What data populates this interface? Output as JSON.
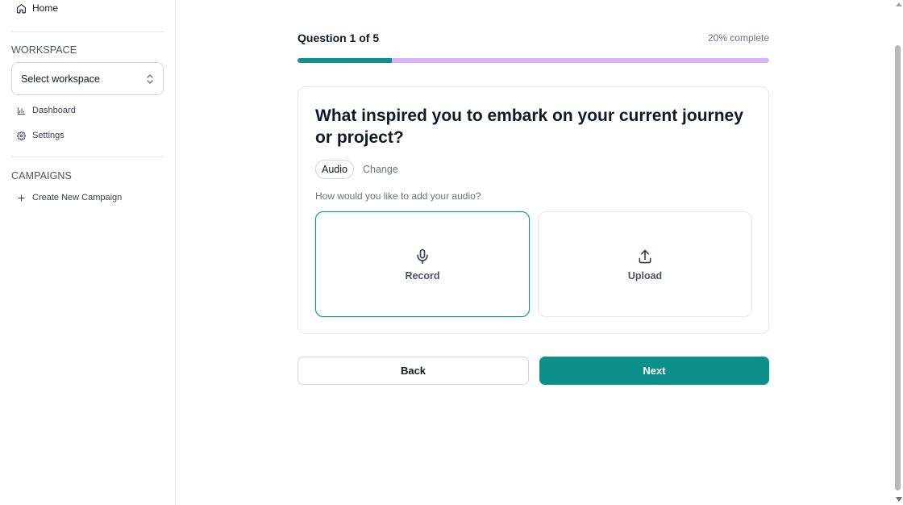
{
  "sidebar": {
    "home_label": "Home",
    "workspace_heading": "WORKSPACE",
    "workspace_select": "Select workspace",
    "items": [
      {
        "label": "Dashboard",
        "icon": "bar-chart-icon"
      },
      {
        "label": "Settings",
        "icon": "gear-icon"
      }
    ],
    "campaigns_heading": "CAMPAIGNS",
    "create_campaign_label": "Create New Campaign"
  },
  "progress": {
    "title": "Question 1 of 5",
    "status": "20% complete",
    "percent": 20
  },
  "question": {
    "text": "What inspired you to embark on your current journey or project?",
    "type_label": "Audio",
    "change_label": "Change",
    "audio_prompt": "How would you like to add your audio?",
    "options": [
      {
        "label": "Record",
        "icon": "microphone-icon",
        "selected": true
      },
      {
        "label": "Upload",
        "icon": "upload-icon",
        "selected": false
      }
    ]
  },
  "actions": {
    "back_label": "Back",
    "next_label": "Next"
  },
  "colors": {
    "accent": "#0d9488",
    "progress_track": "#d8b4fe"
  }
}
